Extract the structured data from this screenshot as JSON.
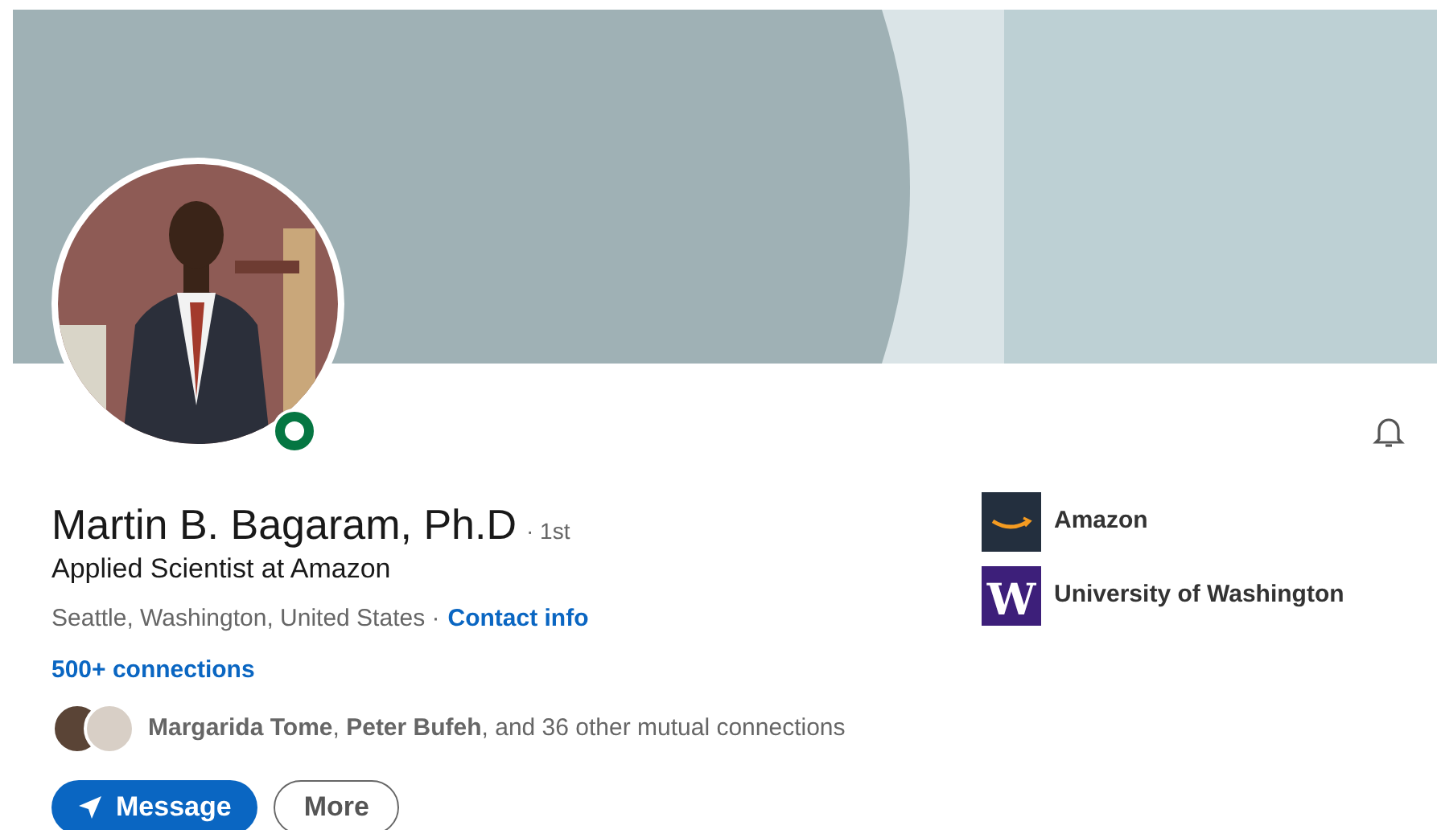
{
  "profile_photo": {
    "online": true
  },
  "name": "Martin B. Bagaram, Ph.D",
  "degree": "· 1st",
  "headline": "Applied Scientist at Amazon",
  "location": "Seattle, Washington, United States ·",
  "contact_link": "Contact info",
  "connections_link": "500+ connections",
  "mutual_connections": "**Margarida Tome**, **Peter Bufeh**, and 36 other mutual connections",
  "organizations": [
    {
      "kind": "smile",
      "name": "Amazon"
    },
    {
      "kind": "letter",
      "logo_text": "W",
      "name": "University of Washington"
    }
  ],
  "buttons": [
    {
      "label": "Message",
      "primary": true
    },
    {
      "label": "More",
      "primary": false
    }
  ]
}
